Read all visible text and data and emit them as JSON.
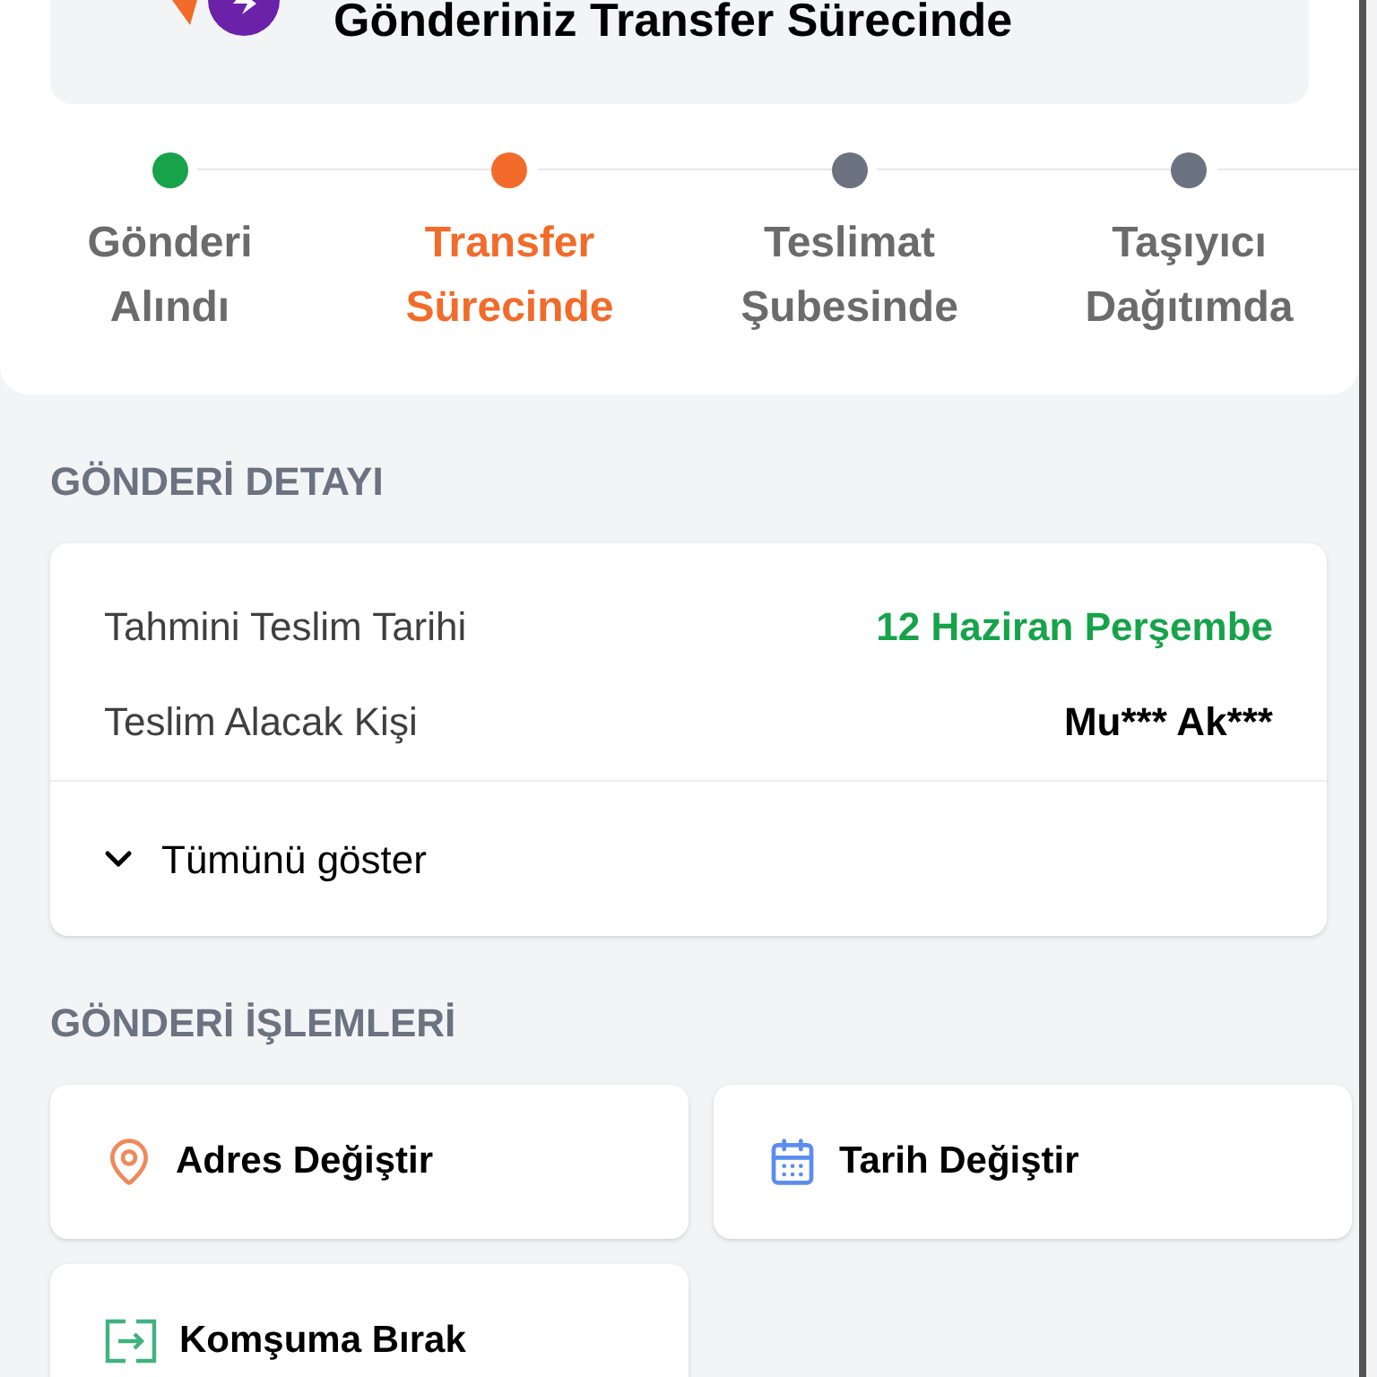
{
  "banner": {
    "title": "Gönderiniz Transfer Sürecinde"
  },
  "steps": [
    {
      "label": "Gönderi Alındı",
      "color": "#16a34a",
      "selected": false
    },
    {
      "label": "Transfer Sürecinde",
      "color": "#f26b2a",
      "selected": true
    },
    {
      "label": "Teslimat Şubesinde",
      "color": "#6b7280",
      "selected": false
    },
    {
      "label": "Taşıyıcı Dağıtımda",
      "color": "#6b7280",
      "selected": false
    }
  ],
  "detail": {
    "heading": "GÖNDERİ DETAYI",
    "rows": [
      {
        "label": "Tahmini Teslim Tarihi",
        "value": "12 Haziran Perşembe",
        "kind": "highlight"
      },
      {
        "label": "Teslim Alacak Kişi",
        "value": "Mu*** Ak***",
        "kind": "plain"
      }
    ],
    "expand": {
      "label": "Tümünü göster",
      "expanded": false
    }
  },
  "actions": {
    "heading": "GÖNDERİ İŞLEMLERİ",
    "items": [
      {
        "label": "Adres Değiştir",
        "kind": "address"
      },
      {
        "label": "Tarih Değiştir",
        "kind": "date"
      },
      {
        "label": "Komşuma Bırak",
        "kind": "neighbor"
      }
    ]
  }
}
